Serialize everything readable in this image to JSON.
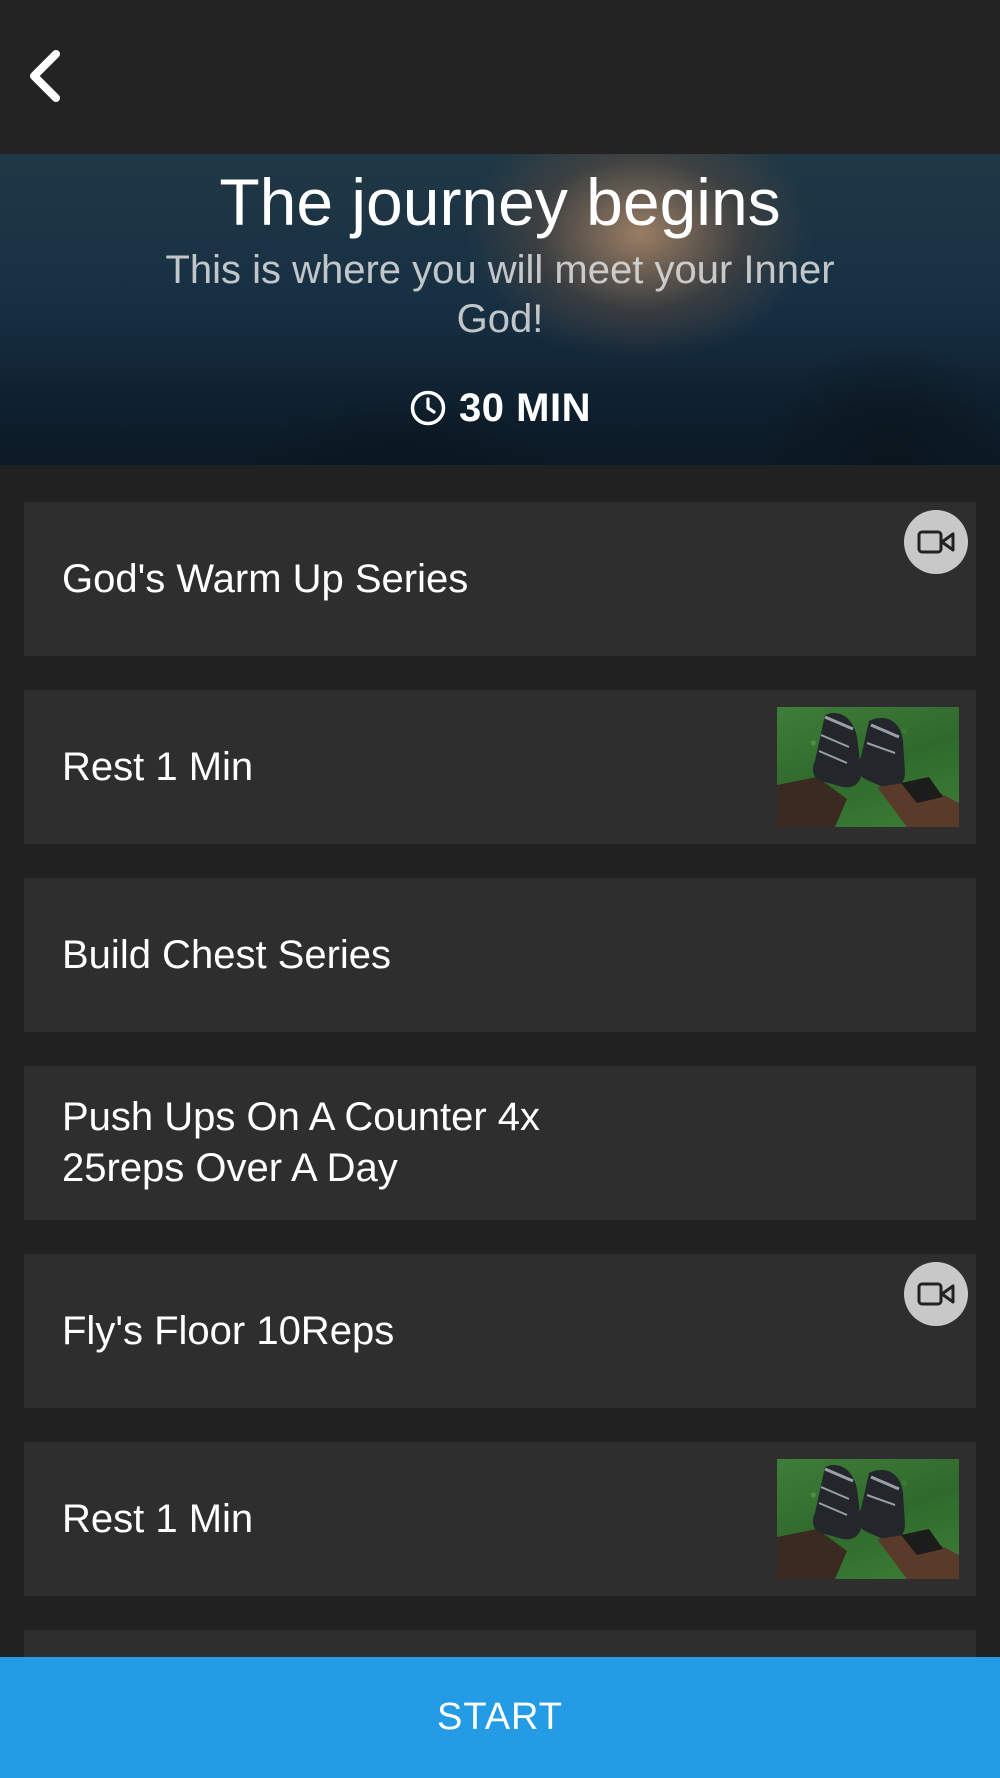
{
  "header": {
    "back_icon": "chevron-left-icon"
  },
  "hero": {
    "title": "The journey begins",
    "subtitle": "This is where you will meet your Inner God!",
    "duration_icon": "clock-icon",
    "duration": "30 MIN"
  },
  "workout_items": [
    {
      "label": "God's Warm Up Series",
      "media": "video-icon"
    },
    {
      "label": "Rest 1 Min",
      "media": "thumbnail"
    },
    {
      "label": "Build Chest Series",
      "media": ""
    },
    {
      "label": "Push Ups On A Counter 4x 25reps Over A Day",
      "media": ""
    },
    {
      "label": "Fly's Floor 10Reps",
      "media": "video-icon"
    },
    {
      "label": "Rest 1 Min",
      "media": "thumbnail"
    },
    {
      "label": "",
      "media": ""
    }
  ],
  "footer": {
    "start_label": "START"
  },
  "colors": {
    "background": "#212121",
    "card": "#2e2e2e",
    "accent": "#249be5",
    "badge": "#c8c8c8"
  }
}
